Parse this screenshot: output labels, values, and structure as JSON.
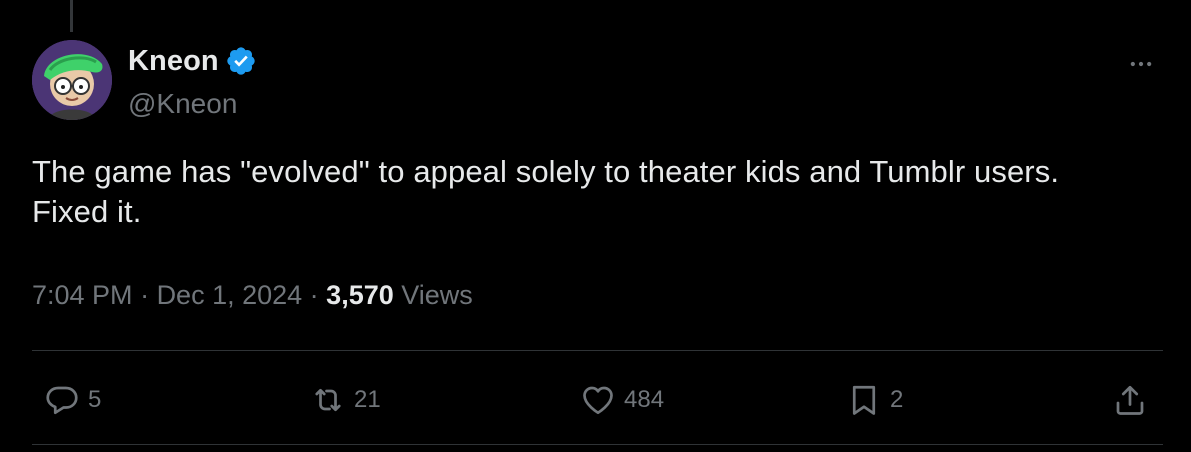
{
  "user": {
    "display_name": "Kneon",
    "handle": "@Kneon",
    "verified": true
  },
  "tweet": {
    "text": "The game has \"evolved\" to appeal solely to theater kids and Tumblr users. Fixed it."
  },
  "meta": {
    "time": "7:04 PM",
    "separator1": " · ",
    "date": "Dec 1, 2024",
    "separator2": " · ",
    "views_count": "3,570",
    "views_label": " Views"
  },
  "actions": {
    "replies": "5",
    "reposts": "21",
    "likes": "484",
    "bookmarks": "2"
  },
  "icons": {
    "more": "more-horizontal-icon",
    "reply": "reply-icon",
    "repost": "repost-icon",
    "like": "heart-icon",
    "bookmark": "bookmark-icon",
    "share": "share-icon",
    "verified": "verified-badge-icon"
  },
  "colors": {
    "background": "#000000",
    "text_primary": "#e7e9ea",
    "text_secondary": "#71767b",
    "verified_blue": "#1d9bf0",
    "divider": "#2f3336"
  }
}
